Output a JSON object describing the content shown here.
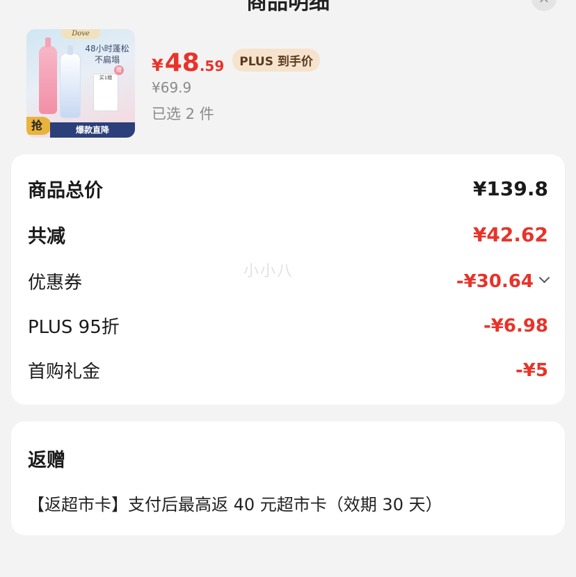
{
  "header": {
    "title": "商品明细",
    "close_icon": "close-icon"
  },
  "product": {
    "thumbnail": {
      "brand": "Dove",
      "promo_line1": "48小时蓬松",
      "promo_line2": "不扁塌",
      "gift_label": "买1赠",
      "grab_tag": "抢",
      "ribbon": "爆款直降"
    },
    "price_currency": "¥",
    "price_int": "48",
    "price_dec": ".59",
    "plus_tag": "PLUS 到手价",
    "original_price": "¥69.9",
    "selected_count": "已选 2 件"
  },
  "summary": {
    "total_label": "商品总价",
    "total_value": "¥139.8",
    "reduce_label": "共减",
    "reduce_value": "¥42.62",
    "coupon_label": "优惠券",
    "coupon_value": "-¥30.64",
    "plus_label": "PLUS 95折",
    "plus_value": "-¥6.98",
    "first_label": "首购礼金",
    "first_value": "-¥5"
  },
  "rebate": {
    "title": "返赠",
    "text": "【返超市卡】支付后最高返 40 元超市卡（效期 30 天）"
  },
  "watermark": "小小八",
  "colors": {
    "accent_red": "#e8332a",
    "plus_tag_bg": "#f6e3cd",
    "ribbon": "#2b3f7a"
  }
}
